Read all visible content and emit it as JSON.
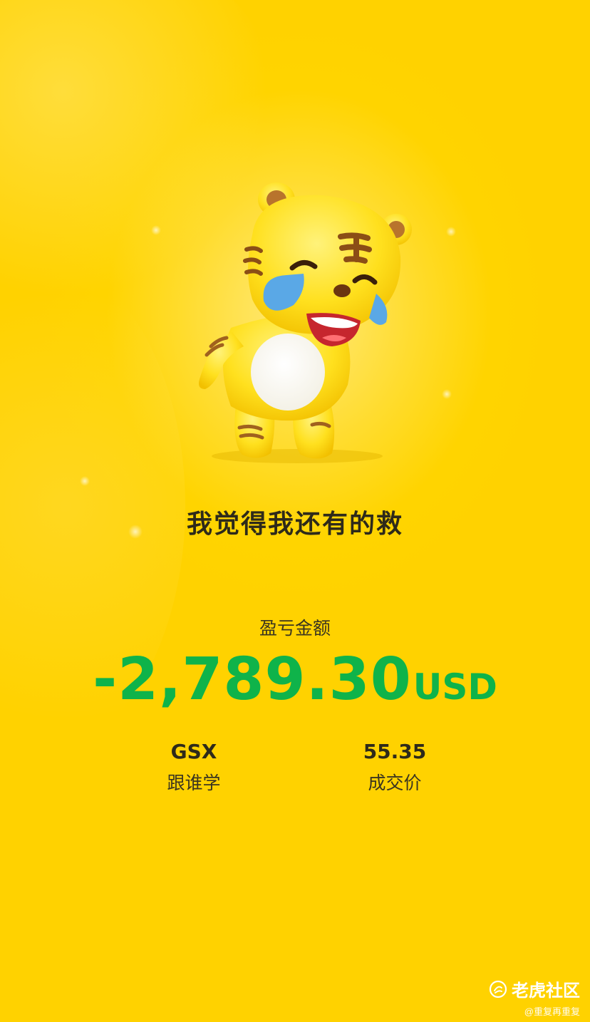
{
  "caption": "我觉得我还有的救",
  "pnl": {
    "label": "盈亏金额",
    "amount": "-2,789.30",
    "currency": "USD",
    "color": "#0fb34a"
  },
  "stock": {
    "symbol": "GSX",
    "name": "跟谁学"
  },
  "price": {
    "value": "55.35",
    "label": "成交价"
  },
  "watermark": {
    "brand": "老虎社区",
    "user": "@重复再重复"
  },
  "colors": {
    "background": "#ffd400",
    "text": "#2e2a1a"
  },
  "icons": {
    "mascot": "crying-tiger-mascot",
    "logo": "tiger-community-logo"
  }
}
